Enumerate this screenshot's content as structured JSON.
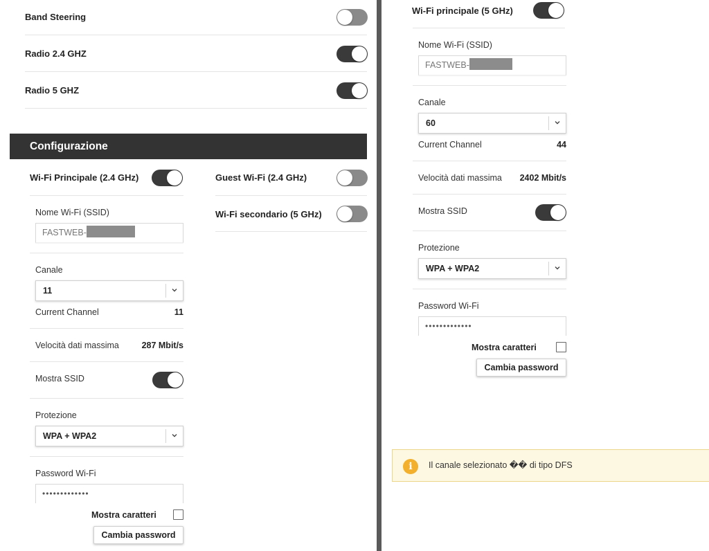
{
  "global": {
    "band_steering": "Band Steering",
    "radio24": "Radio 2.4 GHZ",
    "radio5": "Radio 5 GHZ"
  },
  "config": {
    "title": "Configurazione",
    "wifi24": {
      "title": "Wi-Fi Principale (2.4 GHz)",
      "ssid_label": "Nome Wi-Fi (SSID)",
      "ssid_value": "FASTWEB-",
      "canale_label": "Canale",
      "canale_value": "11",
      "current_channel_label": "Current Channel",
      "current_channel_value": "11",
      "velocita_label": "Velocità dati massima",
      "velocita_value": "287 Mbit/s",
      "mostra_ssid_label": "Mostra SSID",
      "protezione_label": "Protezione",
      "protezione_value": "WPA + WPA2",
      "password_label": "Password Wi-Fi",
      "password_value": "•••••••••••••",
      "mostra_caratteri": "Mostra caratteri",
      "cambia_password": "Cambia password"
    },
    "guest24": {
      "title": "Guest Wi-Fi (2.4 GHz)"
    },
    "secondario5": {
      "title": "Wi-Fi secondario (5 GHz)"
    }
  },
  "wifi5": {
    "title": "Wi-Fi principale (5 GHz)",
    "ssid_label": "Nome Wi-Fi (SSID)",
    "ssid_value": "FASTWEB-",
    "canale_label": "Canale",
    "canale_value": "60",
    "current_channel_label": "Current Channel",
    "current_channel_value": "44",
    "velocita_label": "Velocità dati massima",
    "velocita_value": "2402 Mbit/s",
    "mostra_ssid_label": "Mostra SSID",
    "protezione_label": "Protezione",
    "protezione_value": "WPA + WPA2",
    "password_label": "Password Wi-Fi",
    "password_value": "•••••••••••••",
    "mostra_caratteri": "Mostra caratteri",
    "cambia_password": "Cambia password"
  },
  "alert": {
    "icon": "i",
    "text": "Il canale selezionato �� di tipo DFS"
  },
  "colors": {
    "toggle_on": "#3a3a3a",
    "toggle_off": "#8a8a8a",
    "header": "#333333",
    "alert_bg": "#fdf8e2",
    "alert_icon": "#f2b02d"
  }
}
